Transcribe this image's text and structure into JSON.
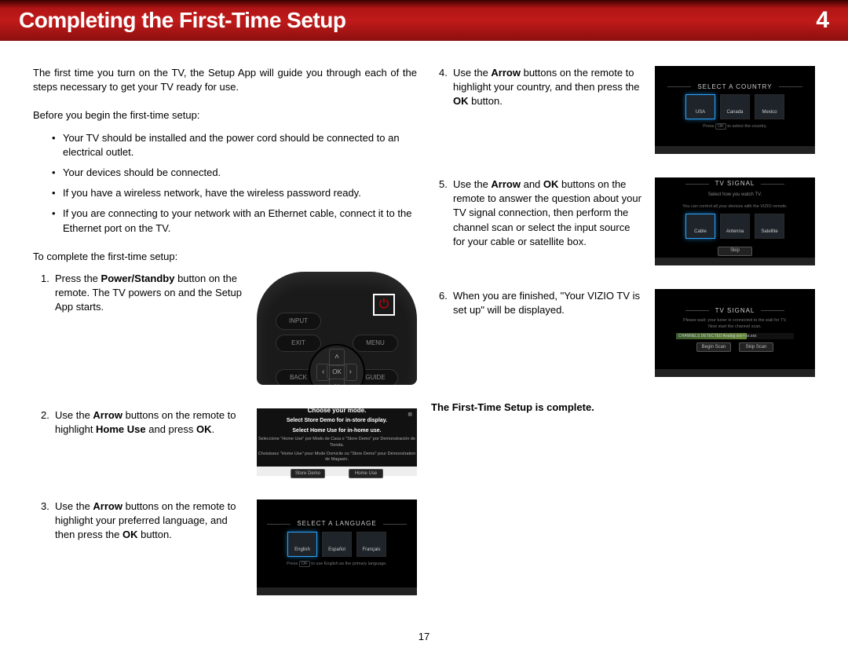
{
  "banner": {
    "title": "Completing the First-Time Setup",
    "chapter": "4"
  },
  "intro": "The first time you turn on the TV, the Setup App will guide you through each of the steps necessary to get your TV ready for use.",
  "before_heading": "Before you begin the first-time setup:",
  "before_items": [
    "Your TV should be installed and the power cord should be connected to an electrical outlet.",
    "Your devices should be connected.",
    "If you have a wireless network, have the wireless password ready.",
    "If you are connecting to your network with an Ethernet cable, connect it to the Ethernet port on the TV."
  ],
  "complete_heading": "To complete the first-time setup:",
  "remote": {
    "buttons": {
      "input": "INPUT",
      "exit": "EXIT",
      "menu": "MENU",
      "back": "BACK",
      "guide": "GUIDE",
      "ok": "OK"
    },
    "power_symbol": "⏻"
  },
  "steps_left": [
    {
      "num": "1.",
      "pre": "Press the ",
      "bold": "Power/Standby",
      "post": " button on the remote. The TV powers on and the Setup App starts."
    },
    {
      "num": "2.",
      "pre": "Use the ",
      "bold": "Arrow",
      "mid": " buttons on the remote to highlight ",
      "bold2": "Home Use",
      "post": " and press ",
      "bold3": "OK",
      "tail": "."
    },
    {
      "num": "3.",
      "pre": "Use the ",
      "bold": "Arrow",
      "mid": " buttons on the remote to highlight your preferred language, and then press the ",
      "bold2": "OK",
      "post": " button."
    }
  ],
  "steps_right": [
    {
      "num": "4.",
      "pre": "Use the ",
      "bold": "Arrow",
      "mid": " buttons on the remote to highlight your country, and then press the ",
      "bold2": "OK",
      "post": " button."
    },
    {
      "num": "5.",
      "pre": "Use the ",
      "bold": "Arrow",
      "mid": " and ",
      "bold2": "OK",
      "post": " buttons on the remote to answer the question about your TV signal connection, then perform the channel scan or select the input source for your cable or satellite box."
    },
    {
      "num": "6.",
      "text": "When you are finished, \"Your VIZIO TV is set up\" will be displayed."
    }
  ],
  "mode_dialog": {
    "line1": "Choose your mode.",
    "line2": "Select Store Demo for in-store display.",
    "line3": "Select Home Use for in-home use.",
    "line4a": "Seleccione \"Home Use\" por Modo de Casa o \"Store Demo\" por Demonstración de Tienda.",
    "line4b": "Choisissez \"Home Use\" pour Mode Domicile ou \"Store Demo\" pour Démonstration de Magasin.",
    "btn_store": "Store Demo",
    "btn_home": "Home Use"
  },
  "lang_screen": {
    "title": "SELECT A LANGUAGE",
    "tiles": [
      "English",
      "Español",
      "Français"
    ],
    "hint_pre": "Press ",
    "hint_btn": "OK",
    "hint_post": " to use English as the primary language."
  },
  "country_screen": {
    "title": "SELECT A COUNTRY",
    "tiles": [
      "USA",
      "Canada",
      "Mexico"
    ],
    "hint_pre": "Press ",
    "hint_btn": "OK",
    "hint_post": " to select the country."
  },
  "signal_screen": {
    "title": "TV SIGNAL",
    "sub": "Select how you watch TV.",
    "sub2": "You can control all your devices with the VIZIO remote.",
    "tiles": [
      "Cable",
      "Antenna",
      "Satellite"
    ],
    "btn": "Skip"
  },
  "scan_screen": {
    "title": "TV SIGNAL",
    "line1": "Please wait: your tuner is connected to the wall for TV.",
    "line2": "Now start the channel scan.",
    "bar": "CHANNELS DETECTED Analog xxx • xx.xxx",
    "btn_left": "Begin Scan",
    "btn_right": "Skip Scan"
  },
  "completion": "The First-Time Setup is complete.",
  "page_number": "17"
}
